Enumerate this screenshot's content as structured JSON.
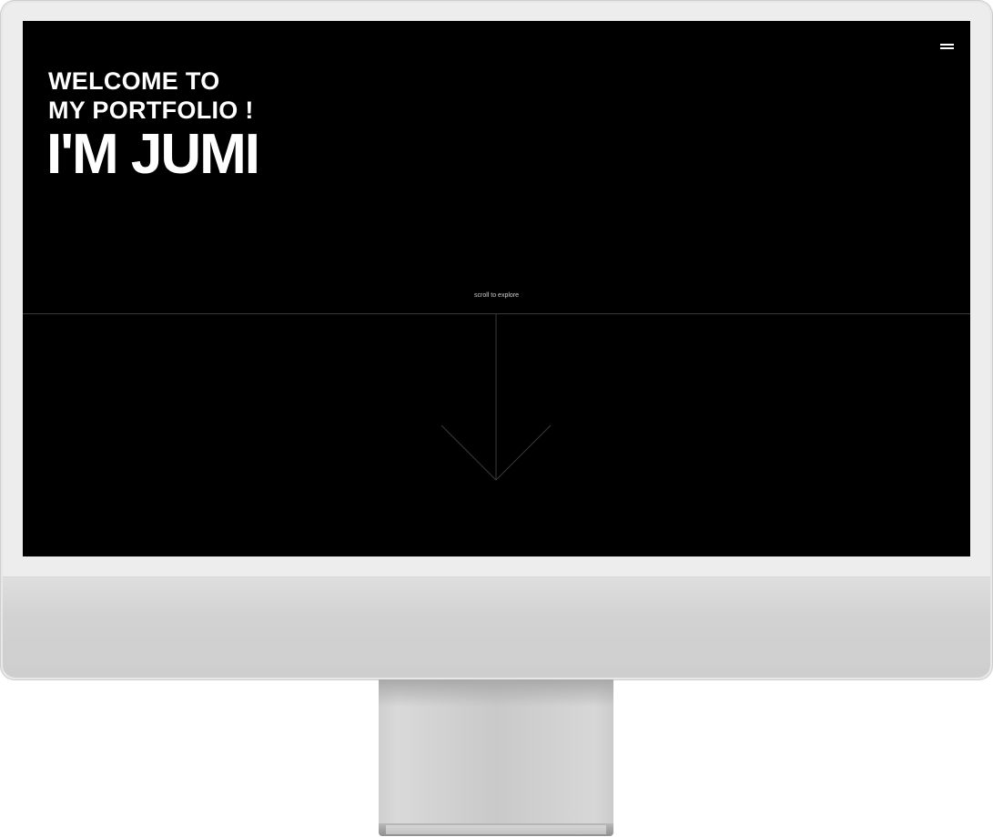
{
  "hero": {
    "welcome_line1": "WELCOME TO",
    "welcome_line2": "MY PORTFOLIO !",
    "name": "I'M JUMI"
  },
  "nav": {
    "menu_icon": "hamburger-menu-icon"
  },
  "scroll": {
    "label": "scroll to explore",
    "icon": "arrow-down-icon"
  },
  "colors": {
    "screen_background": "#000000",
    "text": "#ffffff",
    "device_frame": "#e6e7e7"
  }
}
